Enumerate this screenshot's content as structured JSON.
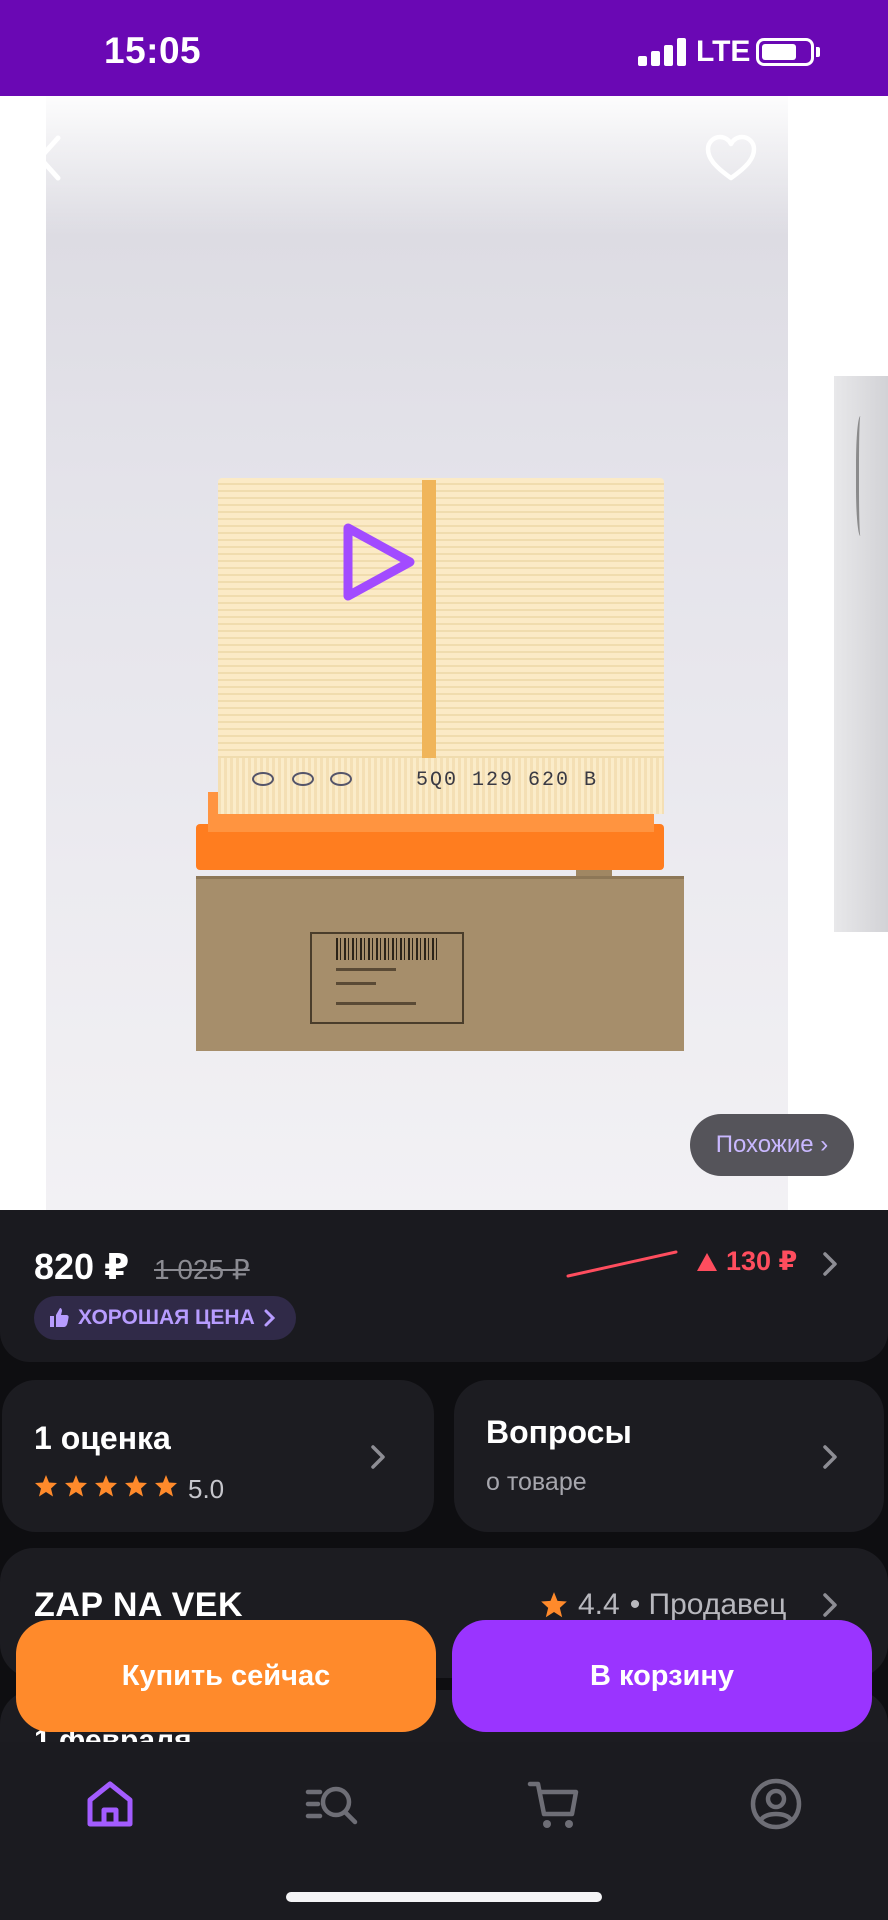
{
  "status_bar": {
    "time": "15:05",
    "network": "LTE"
  },
  "gallery": {
    "similar_label": "Похожие ›",
    "box_label_text": "5Q0 129 620 B",
    "filter_code": "5Q0 129 620 B"
  },
  "price": {
    "current": "820 ₽",
    "old": "1 025 ₽",
    "change": "130 ₽",
    "badge": "ХОРОШАЯ ЦЕНА"
  },
  "rating_card": {
    "title": "1 оценка",
    "value": "5.0",
    "stars": 5
  },
  "questions_card": {
    "title": "Вопросы",
    "subtitle": "о товаре"
  },
  "seller": {
    "name": "ZAP NA VEK",
    "rating": "4.4",
    "label": "• Продавец"
  },
  "delivery": {
    "date": "1 февраля"
  },
  "actions": {
    "buy_now": "Купить сейчас",
    "add_to_cart": "В корзину"
  },
  "colors": {
    "status_bar": "#6a08b4",
    "buy_now": "#ff8a2b",
    "cart": "#9a34ff",
    "price_up": "#ff4d5e",
    "accent": "#b79cff"
  },
  "nav": {
    "items": [
      "home-icon",
      "catalog-search-icon",
      "cart-icon",
      "profile-icon"
    ],
    "active": "home-icon"
  }
}
